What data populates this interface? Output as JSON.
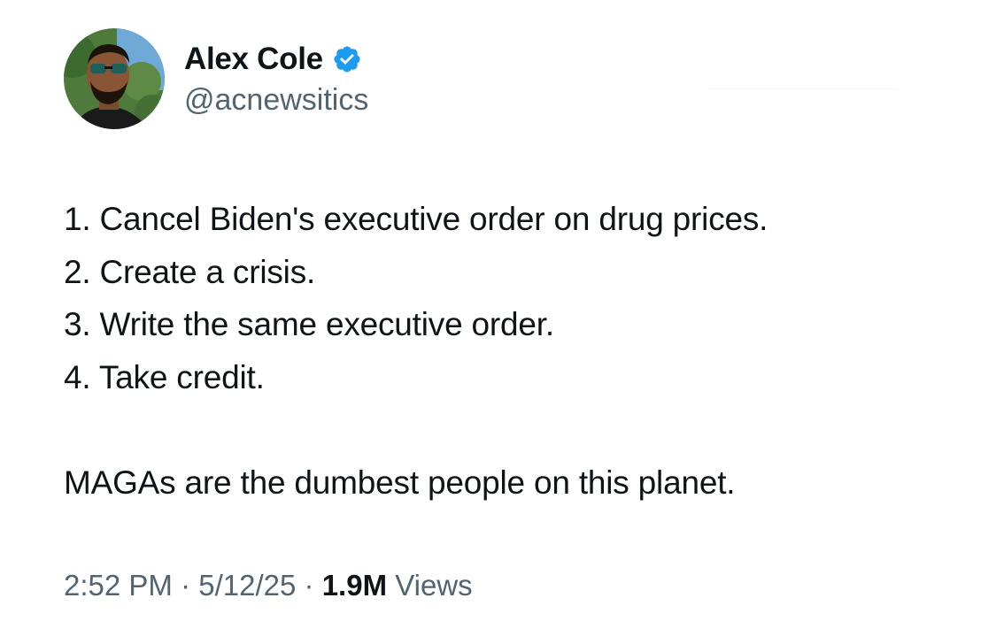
{
  "author": {
    "display_name": "Alex Cole",
    "handle": "@acnewsitics",
    "verified": true,
    "verified_color": "#1d9bf0"
  },
  "tweet": {
    "lines": [
      "1. Cancel Biden's executive order on drug prices.",
      "2. Create a crisis.",
      "3. Write the same executive order.",
      "4. Take credit."
    ],
    "closing": "MAGAs are the dumbest people on this planet."
  },
  "meta": {
    "time": "2:52 PM",
    "separator": "·",
    "date": "5/12/25",
    "views_count": "1.9M",
    "views_label": "Views"
  }
}
